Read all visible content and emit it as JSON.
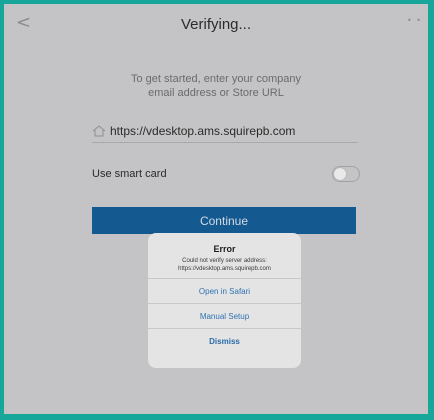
{
  "header": {
    "back_glyph": "<",
    "title": "Verifying...",
    "more_glyph": "• •"
  },
  "intro": {
    "line1": "To get started, enter your company",
    "line2": "email address or Store URL"
  },
  "address_field": {
    "icon": "house-icon",
    "value": "https://vdesktop.ams.squirepb.com"
  },
  "smart_card": {
    "label": "Use smart card",
    "enabled": false
  },
  "continue_label": "Continue",
  "error_dialog": {
    "title": "Error",
    "message_line1": "Could not verify server address:",
    "message_line2": "https://vdesktop.ams.squirepb.com",
    "buttons": [
      "Open in Safari",
      "Manual Setup",
      "Dismiss"
    ]
  },
  "colors": {
    "border": "#17a79a",
    "background": "#c4c4c6",
    "primary_button": "#14598f",
    "link": "#2f73b2"
  }
}
